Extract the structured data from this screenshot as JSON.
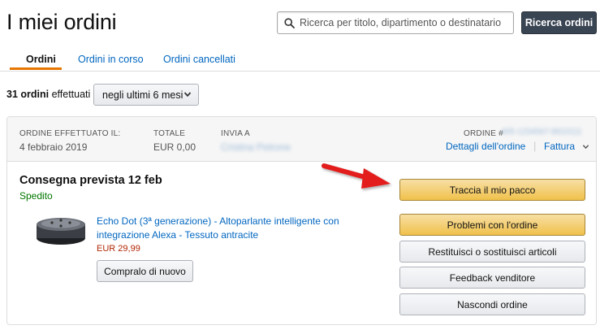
{
  "page": {
    "title": "I miei ordini"
  },
  "search": {
    "placeholder": "Ricerca per titolo, dipartimento o destinatario",
    "button_label": "Ricerca ordini"
  },
  "tabs": [
    {
      "label": "Ordini",
      "active": true
    },
    {
      "label": "Ordini in corso",
      "active": false
    },
    {
      "label": "Ordini cancellati",
      "active": false
    }
  ],
  "filter": {
    "count_bold": "31 ordini",
    "count_rest": "effettuati",
    "period": "negli ultimi 6 mesi"
  },
  "order": {
    "header": {
      "placed_label": "ORDINE EFFETTUATO IL:",
      "placed_value": "4 febbraio 2019",
      "total_label": "TOTALE",
      "total_value": "EUR 0,00",
      "ship_to_label": "INVIA A",
      "ship_to_value": "Cristina Petrone",
      "order_number_label": "ORDINE #",
      "order_number_value": "405-1234567-8910111",
      "details_link": "Dettagli dell'ordine",
      "invoice_link": "Fattura"
    },
    "delivery_title": "Consegna prevista 12 feb",
    "status": "Spedito",
    "product": {
      "title_line1": "Echo Dot (3ª generazione) - Altoparlante intelligente con",
      "title_line2": "integrazione Alexa - Tessuto antracite",
      "price": "EUR 29,99",
      "buy_again_label": "Compralo di nuovo"
    },
    "actions": {
      "track": "Traccia il mio pacco",
      "problems": "Problemi con l'ordine",
      "return": "Restituisci o sostituisci articoli",
      "feedback": "Feedback venditore",
      "hide": "Nascondi ordine"
    }
  },
  "colors": {
    "link": "#0066c0",
    "status_green": "#007600",
    "price_red": "#b12704",
    "tab_accent": "#e77600",
    "annotation_arrow": "#e31b1b",
    "search_button_bg": "#3a4553"
  },
  "icons": [
    "search-icon",
    "chevron-down-icon",
    "echo-dot-product-image",
    "red-annotation-arrow"
  ]
}
